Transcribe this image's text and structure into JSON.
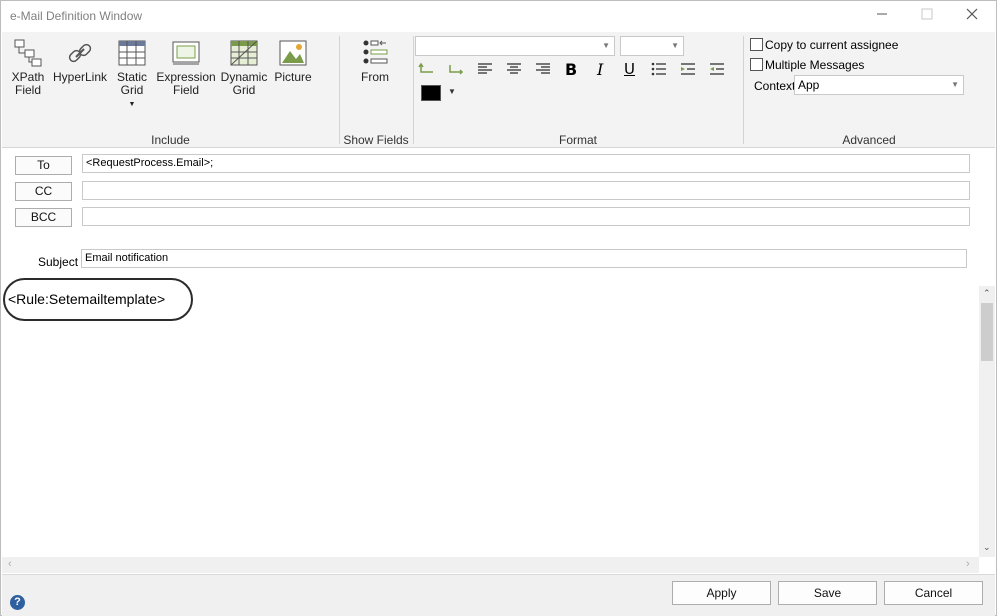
{
  "window": {
    "title": "e-Mail Definition Window"
  },
  "ribbon": {
    "include": {
      "label": "Include",
      "buttons": [
        {
          "label": "XPath\nField"
        },
        {
          "label": "HyperLink"
        },
        {
          "label": "Static\nGrid"
        },
        {
          "label": "Expression\nField"
        },
        {
          "label": "Dynamic\nGrid"
        },
        {
          "label": "Picture"
        }
      ]
    },
    "show_fields": {
      "label": "Show Fields",
      "from_label": "From"
    },
    "format": {
      "label": "Format",
      "font_color": "#000000"
    },
    "advanced": {
      "label": "Advanced",
      "copy_to_assignee": "Copy to current assignee",
      "multiple_messages": "Multiple Messages",
      "context_label": "Context",
      "context_value": "App"
    }
  },
  "fields": {
    "to_label": "To",
    "to_value": "<RequestProcess.Email>;",
    "cc_label": "CC",
    "cc_value": "",
    "bcc_label": "BCC",
    "bcc_value": "",
    "subject_label": "Subject",
    "subject_value": "Email notification"
  },
  "body": {
    "text": "<Rule:Setemailtemplate>"
  },
  "footer": {
    "apply": "Apply",
    "save": "Save",
    "cancel": "Cancel"
  }
}
